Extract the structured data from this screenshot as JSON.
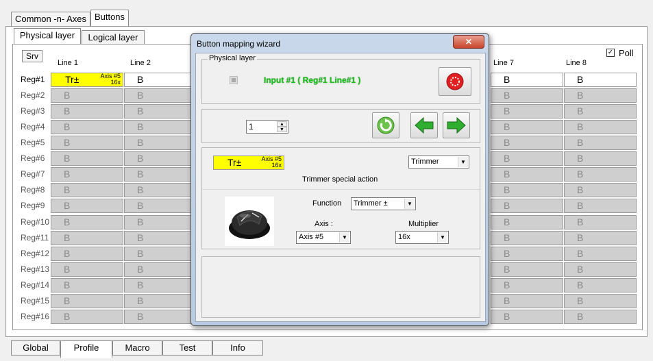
{
  "top_tabs": [
    "Common -n- Axes",
    "Buttons"
  ],
  "layer_tabs": [
    "Physical layer",
    "Logical layer"
  ],
  "srv_label": "Srv",
  "poll_label": "Poll",
  "columns": [
    "Line 1",
    "Line 2",
    "Line 7",
    "Line 8"
  ],
  "rows": [
    "Reg#1",
    "Reg#2",
    "Reg#3",
    "Reg#4",
    "Reg#5",
    "Reg#6",
    "Reg#7",
    "Reg#8",
    "Reg#9",
    "Reg#10",
    "Reg#11",
    "Reg#12",
    "Reg#13",
    "Reg#14",
    "Reg#15",
    "Reg#16"
  ],
  "cell_text": "B",
  "yellow_cell": {
    "label": "Tr±",
    "axis": "Axis #5",
    "mult": "16x"
  },
  "bottom_tabs": [
    "Global",
    "Profile",
    "Macro",
    "Test",
    "Info"
  ],
  "dialog": {
    "title": "Button mapping wizard",
    "close": "✕",
    "physical_group": "Physical layer",
    "input_text": "Input #1  ( Reg#1  Line#1 )",
    "spin_value": "1",
    "mapping": {
      "label": "Tr±",
      "axis": "Axis #5",
      "mult": "16x"
    },
    "action_select": "Trimmer",
    "special_action": "Trimmer special action",
    "function_label": "Function",
    "function_value": "Trimmer ±",
    "axis_label": "Axis :",
    "axis_value": "Axis #5",
    "multiplier_label": "Multiplier",
    "multiplier_value": "16x"
  },
  "colors": {
    "accent_green": "#20c020",
    "cell_grey": "#cfcfcf",
    "yellow": "#ffff00",
    "red": "#e02020"
  }
}
